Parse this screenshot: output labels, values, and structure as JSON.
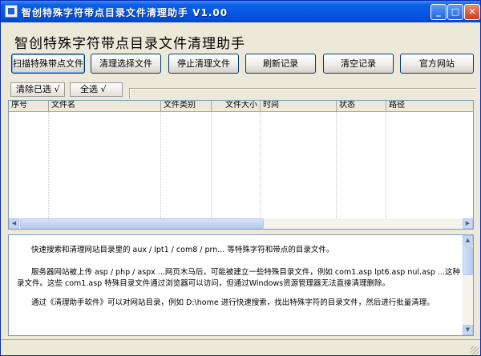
{
  "window": {
    "title": "智创特殊字符带点目录文件清理助手  V1.00",
    "controls": {
      "minimize": "_",
      "maximize": "□",
      "close": "✕"
    }
  },
  "heading": "智创特殊字符带点目录文件清理助手",
  "toolbar": {
    "scan_label": "扫描特殊带点文件",
    "clean_selected_label": "清理选择文件",
    "stop_label": "停止清理文件",
    "refresh_label": "刷新记录",
    "clear_records_label": "清空记录",
    "website_label": "官方网站"
  },
  "selection": {
    "clear_selected_label": "清除已选 √",
    "select_all_label": "全选 √"
  },
  "table": {
    "columns": [
      "序号",
      "文件名",
      "文件类别",
      "文件大小",
      "时间",
      "状态",
      "路径"
    ],
    "rows": []
  },
  "description": {
    "line1": "快速搜索和清理网站目录里的 aux / lpt1 / com8 / prn... 等特殊字符和带点的目录文件。",
    "line2": "服务器网站被上传 asp / php / aspx ...网页木马后，可能被建立一些特殊目录文件，例如 com1.asp lpt6.asp nul.asp ...这种",
    "line3": "录文件。这些 com1.asp 特殊目录文件通过浏览器可以访问，但通过Windows资源管理器无法直接清理删除。",
    "line4": "通过《清理助手软件》可以对网站目录，例如 D:\\home 进行快速搜索，找出特殊字符的目录文件，然后进行批量清理。"
  },
  "colors": {
    "titlebar": "#0554e0",
    "window_bg": "#ece9d8",
    "button_border": "#003c74",
    "list_border": "#7f9db9"
  },
  "icons": [
    "app-icon",
    "minimize-icon",
    "maximize-icon",
    "close-icon",
    "arrow-left-icon",
    "arrow-right-icon",
    "arrow-up-icon",
    "arrow-down-icon"
  ]
}
